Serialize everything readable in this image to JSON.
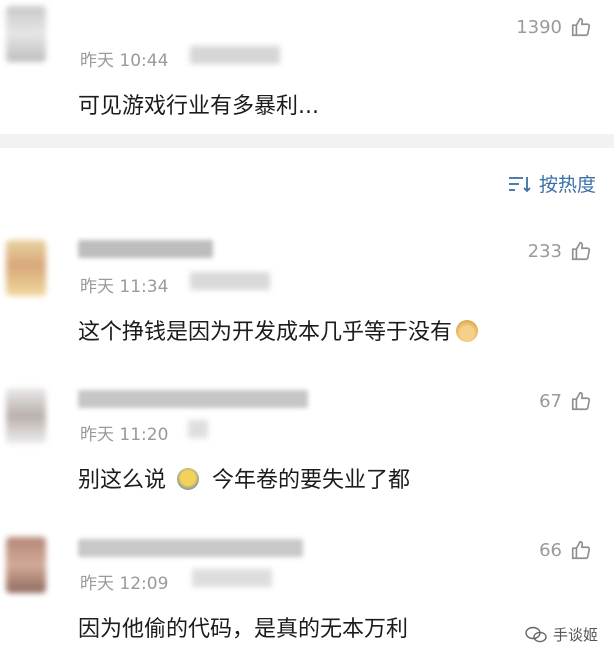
{
  "comments": [
    {
      "time": "昨天 10:44",
      "text": "可见游戏行业有多暴利...",
      "likes": "1390"
    },
    {
      "time": "昨天 11:34",
      "text": "这个挣钱是因为开发成本几乎等于没有",
      "likes": "233"
    },
    {
      "time": "昨天 11:20",
      "text_a": "别这么说",
      "text_b": "今年卷的要失业了都",
      "likes": "67"
    },
    {
      "time": "昨天 12:09",
      "text": "因为他偷的代码，是真的无本万利",
      "likes": "66"
    }
  ],
  "sort": {
    "label": "按热度"
  },
  "watermark": {
    "label": "手谈姬"
  },
  "colors": {
    "link": "#3a6fa8",
    "meta": "#9a9a9a",
    "divider": "#f2f2f2"
  }
}
